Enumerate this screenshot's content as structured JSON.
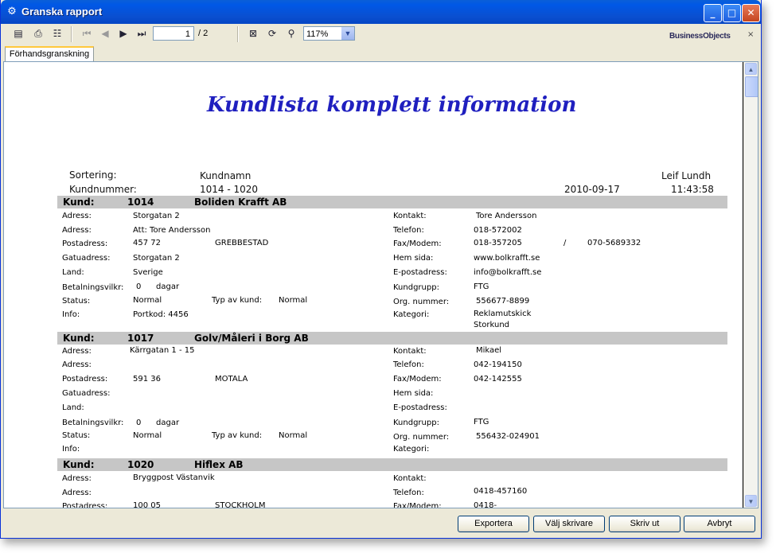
{
  "window": {
    "title": "Granska rapport"
  },
  "toolbar": {
    "page_current": "1",
    "page_total": "/ 2",
    "zoom": "117%",
    "brand": "BusinessObjects",
    "brand_close": "×"
  },
  "tab": {
    "label": "Förhandsgranskning"
  },
  "report": {
    "title": "Kundlista komplett information",
    "sort_label": "Sortering:",
    "sort_value": "Kundnamn",
    "user": "Leif Lundh",
    "range_label": "Kundnummer:",
    "range_value": "1014 - 1020",
    "date": "2010-09-17",
    "time": "11:43:58",
    "labels": {
      "kund": "Kund:",
      "adress": "Adress:",
      "postadress": "Postadress:",
      "gatuadress": "Gatuadress:",
      "land": "Land:",
      "betalning": "Betalningsvilkr:",
      "status": "Status:",
      "info": "Info:",
      "typ": "Typ av kund:",
      "kontakt": "Kontakt:",
      "telefon": "Telefon:",
      "fax": "Fax/Modem:",
      "hemsida": "Hem sida:",
      "epost": "E-postadress:",
      "kundgrupp": "Kundgrupp:",
      "orgnr": "Org. nummer:",
      "kategori": "Kategori:",
      "dagar": "dagar",
      "slash": "/"
    },
    "customers": [
      {
        "nr": "1014",
        "name": "Boliden Krafft AB",
        "adress": "Storgatan 2",
        "adress2": "Att: Tore Andersson",
        "postnr": "457 72",
        "ort": "GREBBESTAD",
        "gatuadress": "Storgatan 2",
        "land": "Sverige",
        "betalning": "0",
        "status": "Normal",
        "typ": "Normal",
        "info": "Portkod: 4456",
        "kontakt": "Tore Andersson",
        "telefon": "018-572002",
        "fax": "018-357205",
        "fax2": "070-5689332",
        "hemsida": "www.bolkrafft.se",
        "epost": "info@bolkrafft.se",
        "kundgrupp": "FTG",
        "orgnr": "556677-8899",
        "kategori": "Reklamutskick",
        "kategori2": "Storkund"
      },
      {
        "nr": "1017",
        "name": "Golv/Måleri i Borg AB",
        "adress": "Kärrgatan 1 - 15",
        "postnr": "591 36",
        "ort": "MOTALA",
        "betalning": "0",
        "status": "Normal",
        "typ": "Normal",
        "kontakt": "Mikael",
        "telefon": "042-194150",
        "fax": "042-142555",
        "kundgrupp": "FTG",
        "orgnr": "556432-024901"
      },
      {
        "nr": "1020",
        "name": "Hiflex AB",
        "adress": "Bryggpost Västanvik",
        "postnr": "100 05",
        "ort": "STOCKHOLM",
        "telefon": "0418-457160",
        "fax": "0418-"
      }
    ]
  },
  "buttons": {
    "export": "Exportera",
    "printer": "Välj skrivare",
    "print": "Skriv ut",
    "cancel": "Avbryt"
  }
}
